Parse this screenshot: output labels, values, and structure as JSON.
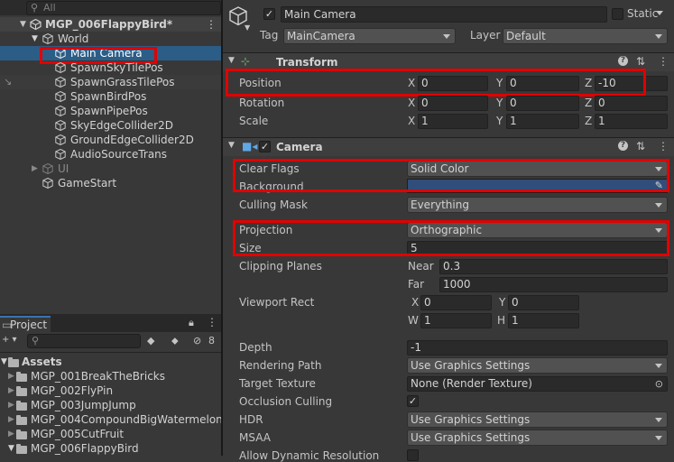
{
  "hierarchy": {
    "search_placeholder": "All",
    "scene": "MGP_006FlappyBird*",
    "items": [
      {
        "label": "World"
      },
      {
        "label": "Main Camera"
      },
      {
        "label": "SpawnSkyTilePos"
      },
      {
        "label": "SpawnGrassTilePos"
      },
      {
        "label": "SpawnBirdPos"
      },
      {
        "label": "SpawnPipePos"
      },
      {
        "label": "SkyEdgeCollider2D"
      },
      {
        "label": "GroundEdgeCollider2D"
      },
      {
        "label": "AudioSourceTrans"
      },
      {
        "label": "UI"
      },
      {
        "label": "GameStart"
      }
    ]
  },
  "project": {
    "tab_label": "Project",
    "hidden_count": "8",
    "root": "Assets",
    "folders": [
      "MGP_001BreakTheBricks",
      "MGP_002FlyPin",
      "MGP_003JumpJump",
      "MGP_004CompoundBigWatermelon",
      "MGP_005CutFruit",
      "MGP_006FlappyBird"
    ]
  },
  "inspector": {
    "object_name": "Main Camera",
    "static_label": "Static",
    "tag_label": "Tag",
    "tag_value": "MainCamera",
    "layer_label": "Layer",
    "layer_value": "Default",
    "transform": {
      "title": "Transform",
      "position": {
        "label": "Position",
        "x": "0",
        "y": "0",
        "z": "-10"
      },
      "rotation": {
        "label": "Rotation",
        "x": "0",
        "y": "0",
        "z": "0"
      },
      "scale": {
        "label": "Scale",
        "x": "1",
        "y": "1",
        "z": "1"
      }
    },
    "axis": {
      "x": "X",
      "y": "Y",
      "z": "Z",
      "w": "W",
      "h": "H"
    },
    "camera": {
      "title": "Camera",
      "clear_flags": {
        "label": "Clear Flags",
        "value": "Solid Color"
      },
      "background": {
        "label": "Background",
        "color": "#314d79"
      },
      "culling_mask": {
        "label": "Culling Mask",
        "value": "Everything"
      },
      "projection": {
        "label": "Projection",
        "value": "Orthographic"
      },
      "size": {
        "label": "Size",
        "value": "5"
      },
      "clipping": {
        "label": "Clipping Planes",
        "near_label": "Near",
        "near": "0.3",
        "far_label": "Far",
        "far": "1000"
      },
      "viewport": {
        "label": "Viewport Rect",
        "x": "0",
        "y": "0",
        "w": "1",
        "h": "1"
      },
      "depth": {
        "label": "Depth",
        "value": "-1"
      },
      "rendering_path": {
        "label": "Rendering Path",
        "value": "Use Graphics Settings"
      },
      "target_texture": {
        "label": "Target Texture",
        "value": "None (Render Texture)"
      },
      "occlusion_culling": {
        "label": "Occlusion Culling"
      },
      "hdr": {
        "label": "HDR",
        "value": "Use Graphics Settings"
      },
      "msaa": {
        "label": "MSAA",
        "value": "Use Graphics Settings"
      },
      "allow_dynamic_resolution": {
        "label": "Allow Dynamic Resolution"
      }
    }
  },
  "colors": {
    "highlight": "#e10000",
    "selection": "#2c5d87"
  }
}
